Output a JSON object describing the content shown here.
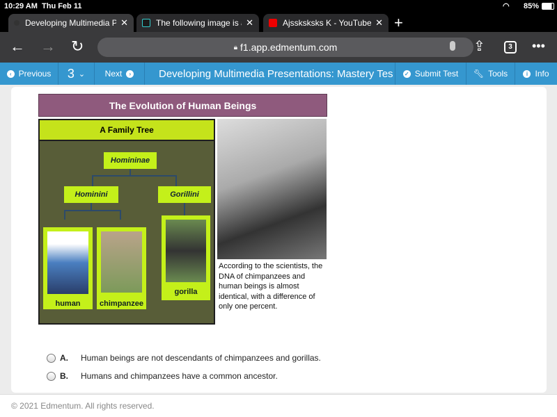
{
  "status_bar": {
    "time": "10:29 AM",
    "date": "Thu Feb 11",
    "battery": "85%"
  },
  "tabs": [
    {
      "label": "Developing Multimedia Presentations: Mastery Test",
      "active": true
    },
    {
      "label": "The following image is a",
      "active": false
    },
    {
      "label": "Ajssksksks K - YouTube",
      "active": false
    }
  ],
  "browser": {
    "url": "f1.app.edmentum.com",
    "tab_count": "3"
  },
  "nav": {
    "previous": "Previous",
    "question_number": "3",
    "next": "Next",
    "title": "Developing Multimedia Presentations: Mastery Tes",
    "submit": "Submit Test",
    "tools": "Tools",
    "info": "Info"
  },
  "figure": {
    "title": "The Evolution of Human Beings",
    "tree_title": "A Family Tree",
    "root": "Homininae",
    "branches": [
      "Hominini",
      "Gorillini"
    ],
    "leaves": [
      "human",
      "chimpanzee",
      "gorilla"
    ],
    "caption": "According to the scientists, the DNA of chimpanzees and human beings is almost identical, with a difference of only one percent."
  },
  "options": [
    {
      "letter": "A.",
      "text": "Human beings are not descendants of chimpanzees and gorillas."
    },
    {
      "letter": "B.",
      "text": "Humans and chimpanzees have a common ancestor."
    }
  ],
  "footer": "© 2021 Edmentum. All rights reserved.",
  "colors": {
    "nav_blue": "#3597cf",
    "title_purple": "#8f5a7d",
    "tree_lime": "#c4f01a",
    "tree_olive": "#585d38"
  }
}
